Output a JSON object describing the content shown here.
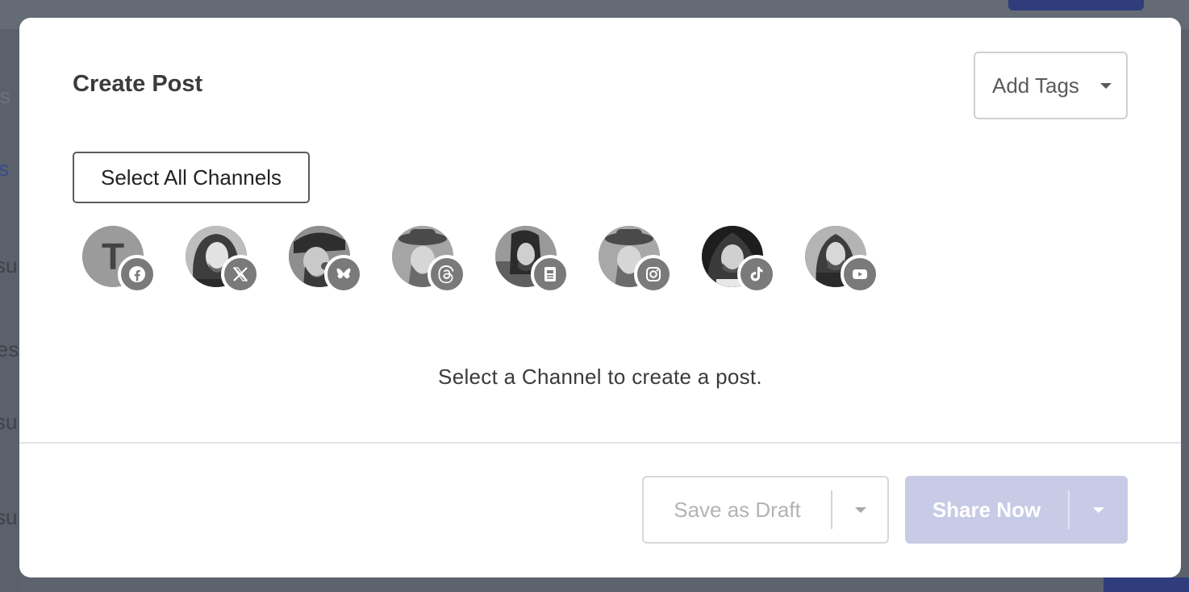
{
  "modal": {
    "title": "Create Post",
    "add_tags_label": "Add Tags",
    "select_all_label": "Select All Channels",
    "empty_message": "Select a Channel to create a post.",
    "save_draft_label": "Save as Draft",
    "share_now_label": "Share Now"
  },
  "channels": [
    {
      "avatar": "letter",
      "letter": "T",
      "network": "facebook-icon"
    },
    {
      "avatar": "photo",
      "network": "x-icon"
    },
    {
      "avatar": "photo",
      "network": "bluesky-icon"
    },
    {
      "avatar": "photo",
      "network": "threads-icon"
    },
    {
      "avatar": "photo",
      "network": "contact-card-icon"
    },
    {
      "avatar": "photo",
      "network": "instagram-icon"
    },
    {
      "avatar": "photo",
      "network": "tiktok-icon"
    },
    {
      "avatar": "photo",
      "network": "youtube-icon"
    }
  ],
  "background": {
    "fragments": [
      "ls",
      "s",
      "su",
      "les",
      "su",
      "su"
    ]
  },
  "colors": {
    "share_disabled": "#c8cbe6",
    "brand_blue": "#2f3d7c",
    "badge_gray": "#7a7a7a"
  }
}
